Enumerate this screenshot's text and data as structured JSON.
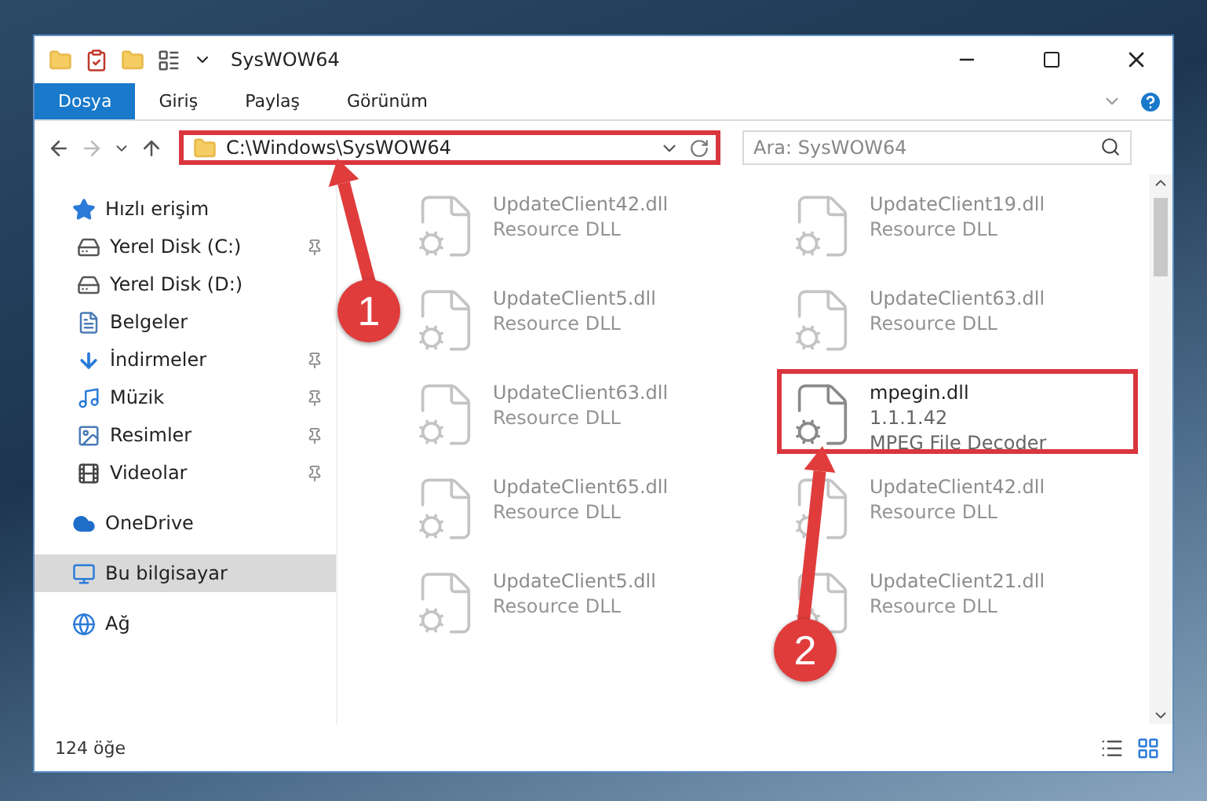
{
  "window": {
    "title": "SysWOW64"
  },
  "ribbon_tabs": [
    {
      "label": "Dosya",
      "selected": true
    },
    {
      "label": "Giriş",
      "selected": false
    },
    {
      "label": "Paylaş",
      "selected": false
    },
    {
      "label": "Görünüm",
      "selected": false
    }
  ],
  "address_bar": {
    "path": "C:\\Windows\\SysWOW64",
    "highlighted": true
  },
  "search": {
    "placeholder": "Ara: SysWOW64"
  },
  "sidebar": {
    "items": [
      {
        "label": "Hızlı erişim",
        "kind": "quick",
        "selected": false,
        "children": [
          {
            "label": "Yerel Disk (C:)",
            "kind": "disk-c",
            "pinned": true,
            "selected": false
          },
          {
            "label": "Yerel Disk (D:)",
            "kind": "disk",
            "pinned": false,
            "selected": false
          },
          {
            "label": "Belgeler",
            "kind": "documents",
            "pinned": false,
            "selected": false
          },
          {
            "label": "İndirmeler",
            "kind": "downloads",
            "pinned": true,
            "selected": false
          },
          {
            "label": "Müzik",
            "kind": "music",
            "pinned": true,
            "selected": false
          },
          {
            "label": "Resimler",
            "kind": "pictures",
            "pinned": true,
            "selected": false
          },
          {
            "label": "Videolar",
            "kind": "videos",
            "pinned": true,
            "selected": false
          }
        ]
      },
      {
        "label": "OneDrive",
        "kind": "cloud",
        "selected": false
      },
      {
        "label": "Bu bilgisayar",
        "kind": "computer",
        "selected": true
      },
      {
        "label": "Ağ",
        "kind": "network",
        "selected": false
      }
    ]
  },
  "files": [
    {
      "name": "UpdateClient42.dll",
      "description": "Resource DLL",
      "blurred": true,
      "highlighted": false
    },
    {
      "name": "UpdateClient19.dll",
      "description": "Resource DLL",
      "blurred": true,
      "highlighted": false
    },
    {
      "name": "UpdateClient5.dll",
      "description": "Resource DLL",
      "blurred": true,
      "highlighted": false
    },
    {
      "name": "UpdateClient63.dll",
      "description": "Resource DLL",
      "blurred": true,
      "highlighted": false
    },
    {
      "name": "UpdateClient63.dll",
      "description": "Resource DLL",
      "blurred": true,
      "highlighted": false
    },
    {
      "name": "mpegin.dll",
      "version": "1.1.1.42",
      "description": "MPEG File Decoder",
      "blurred": false,
      "highlighted": true
    },
    {
      "name": "UpdateClient65.dll",
      "description": "Resource DLL",
      "blurred": true,
      "highlighted": false
    },
    {
      "name": "UpdateClient42.dll",
      "description": "Resource DLL",
      "blurred": true,
      "highlighted": false
    },
    {
      "name": "UpdateClient5.dll",
      "description": "Resource DLL",
      "blurred": true,
      "highlighted": false
    },
    {
      "name": "UpdateClient21.dll",
      "description": "Resource DLL",
      "blurred": true,
      "highlighted": false
    }
  ],
  "status_bar": {
    "item_count": "124 öğe"
  },
  "annotations": [
    {
      "number": "1"
    },
    {
      "number": "2"
    }
  ]
}
